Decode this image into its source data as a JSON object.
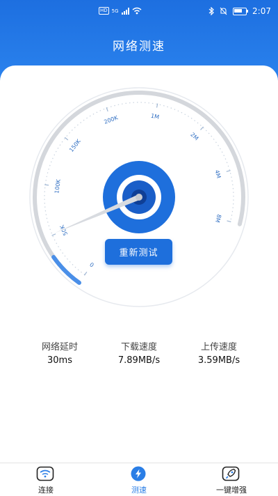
{
  "status_bar": {
    "hd": "HD",
    "network": "5G",
    "time": "2:07"
  },
  "header": {
    "title": "网络测速"
  },
  "gauge": {
    "tick_labels": [
      "0",
      "50K",
      "100K",
      "150K",
      "200K",
      "1M",
      "2M",
      "4M",
      "8M"
    ],
    "progress_fraction": 0.08,
    "accent_color": "#1e6fdc"
  },
  "retest_button": {
    "label": "重新测试"
  },
  "stats": [
    {
      "label": "网络延时",
      "value": "30ms"
    },
    {
      "label": "下载速度",
      "value": "7.89MB/s"
    },
    {
      "label": "上传速度",
      "value": "3.59MB/s"
    }
  ],
  "tabs": [
    {
      "label": "连接",
      "icon": "wifi-icon",
      "active": false
    },
    {
      "label": "测速",
      "icon": "lightning-icon",
      "active": true
    },
    {
      "label": "一键增强",
      "icon": "rocket-icon",
      "active": false
    }
  ]
}
